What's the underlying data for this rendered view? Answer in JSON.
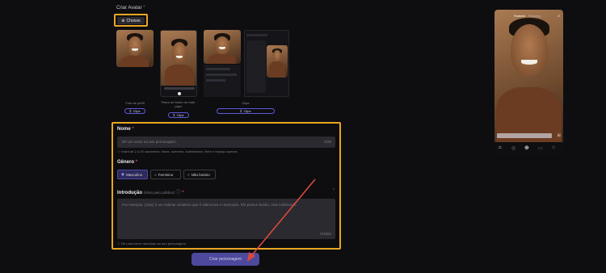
{
  "avatar_section": {
    "label": "Criar Avatar",
    "required_mark": "*",
    "choose_label": "Choose",
    "options": [
      {
        "caption": "Foto de perfil",
        "clip_label": "Clipe"
      },
      {
        "caption": "Plano de fundo do bate-papo",
        "clip_label": "Clipe"
      },
      {
        "caption": "Clipe",
        "clip_label": "Clipe"
      }
    ]
  },
  "form": {
    "name": {
      "label": "Nome",
      "required_mark": "*",
      "placeholder": "Dê um nome ao seu personagem",
      "counter": "0/25",
      "hint": "Insira de 2 a 25 caracteres: letras, números, sublinhados, hífen e espaço apenas."
    },
    "gender": {
      "label": "Gênero",
      "required_mark": "*",
      "options": [
        {
          "label": "Masculino",
          "selected": true
        },
        {
          "label": "Feminino",
          "selected": false
        },
        {
          "label": "Não binário",
          "selected": false
        }
      ]
    },
    "intro": {
      "label": "Introdução",
      "sub_label": "(Visto pelo público)",
      "required_mark": "*",
      "placeholder": "Por exemplo, {char} é um valente cavaleiro que é silencioso e reservado. Ele parece bonito, mas sofisticado",
      "counter": "0/1000",
      "hint": "Dê uma breve descrição ao seu personagem"
    }
  },
  "create_button": {
    "label": "Criar personagem"
  },
  "preview": {
    "tab_active": "Featured",
    "tab_other": "Following"
  },
  "colors": {
    "highlight": "#e8a623",
    "accent": "#4d4a9e",
    "annotation_arrow": "#d94a3a"
  }
}
